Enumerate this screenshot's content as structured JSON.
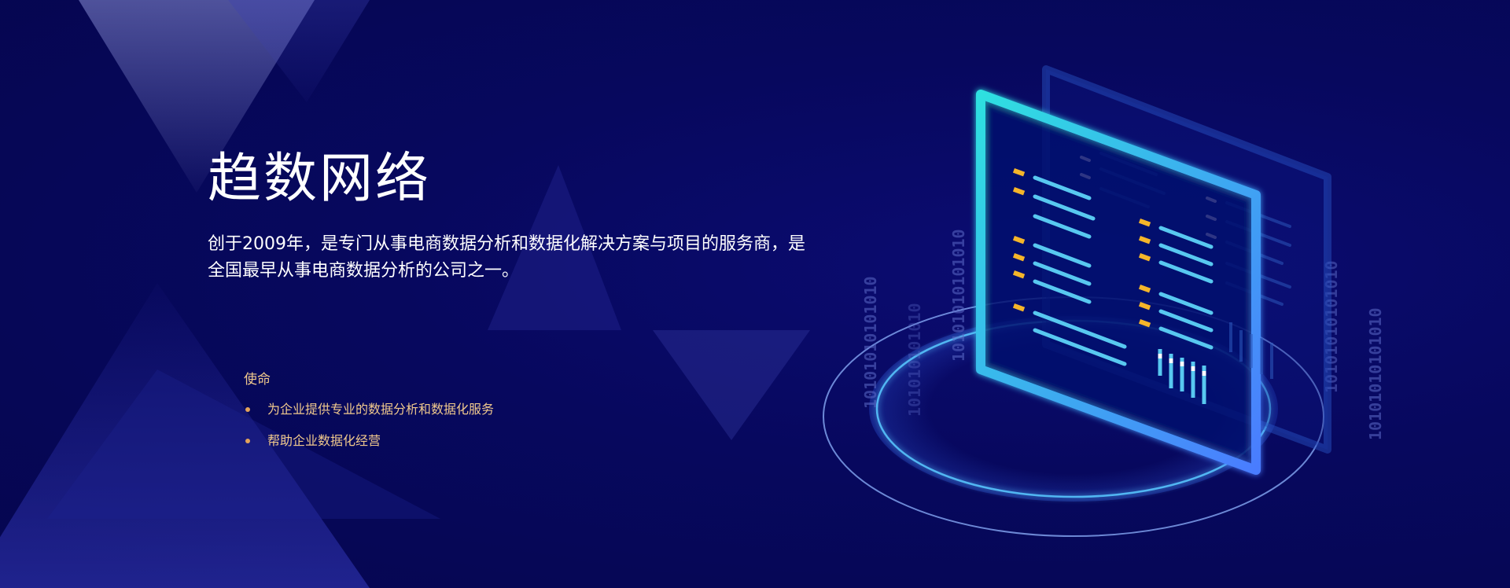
{
  "hero": {
    "title": "趋数网络",
    "description": "创于2009年，是专门从事电商数据分析和数据化解决方案与项目的服务商，是全国最早从事电商数据分析的公司之一。"
  },
  "mission": {
    "label": "使命",
    "items": [
      "为企业提供专业的数据分析和数据化服务",
      "帮助企业数据化经营"
    ]
  },
  "illustration": {
    "binary_text": "10101010101010",
    "binary_text_short": "101010101010",
    "colors": {
      "background": "#06075a",
      "frame_cyan": "#2ee0e0",
      "frame_blue": "#4a7cff",
      "bar_light": "#58c8f0",
      "bar_yellow": "#f5b52a",
      "ring": "#8fb4ff",
      "mission_text": "#f0c98d"
    }
  }
}
